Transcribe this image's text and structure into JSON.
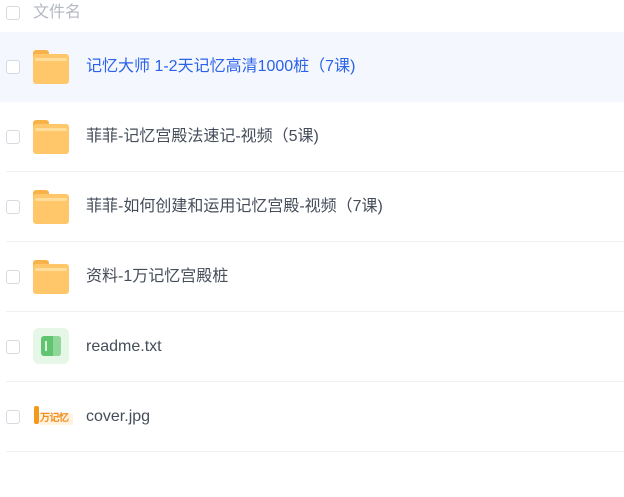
{
  "header": {
    "column_label": "文件名"
  },
  "files": [
    {
      "name": "记忆大师 1-2天记忆高清1000桩（7课)",
      "type": "folder",
      "selected": true
    },
    {
      "name": "菲菲-记忆宫殿法速记-视频（5课)",
      "type": "folder",
      "selected": false
    },
    {
      "name": "菲菲-如何创建和运用记忆宫殿-视频（7课)",
      "type": "folder",
      "selected": false
    },
    {
      "name": "资料-1万记忆宫殿桩",
      "type": "folder",
      "selected": false
    },
    {
      "name": "readme.txt",
      "type": "txt",
      "selected": false
    },
    {
      "name": "cover.jpg",
      "type": "jpg",
      "selected": false,
      "thumbnail_text": "万记忆"
    }
  ],
  "colors": {
    "selected_row_bg": "#f5f7ff",
    "selected_text": "#2a62e8",
    "text": "#454d5a",
    "folder": "#ffc66a",
    "txt_icon": "#61c471"
  }
}
